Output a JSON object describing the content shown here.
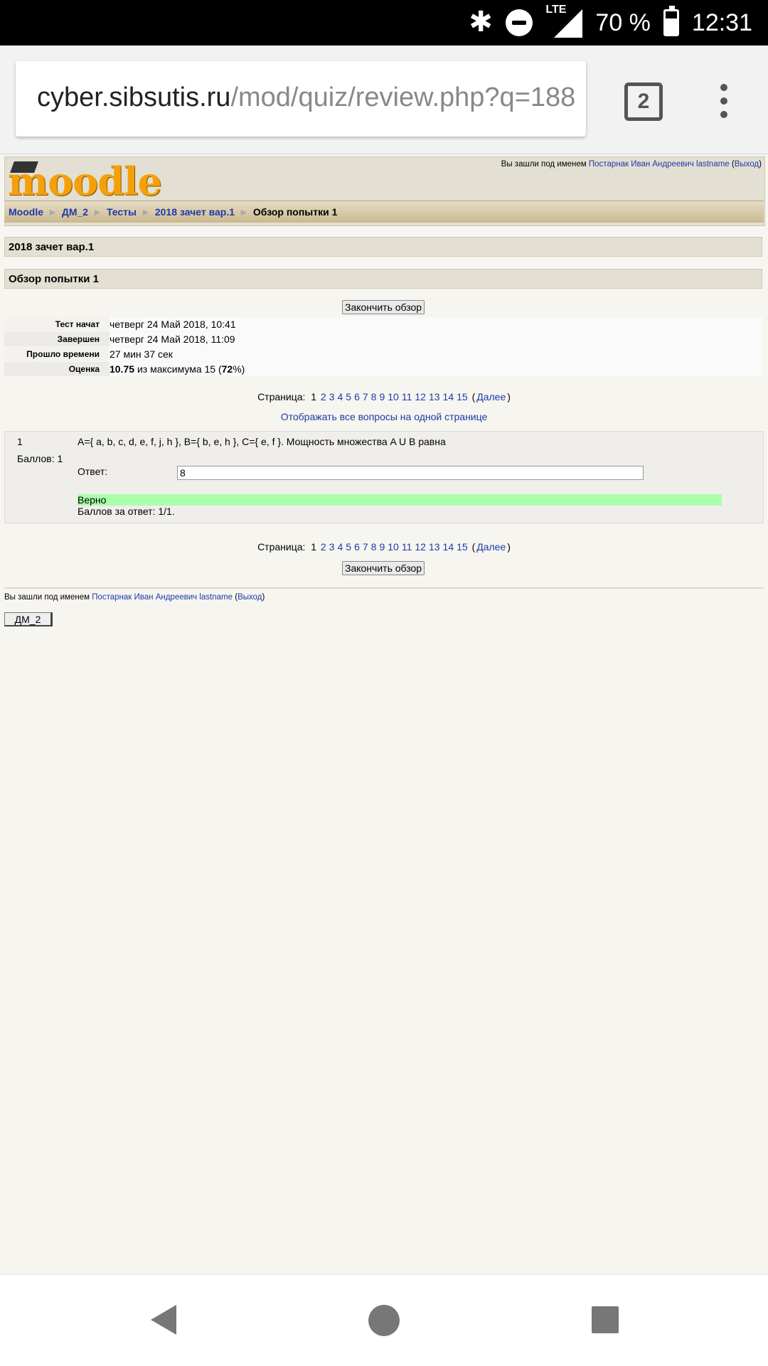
{
  "status_bar": {
    "battery": "70 %",
    "time": "12:31",
    "network": "LTE",
    "battery_level": 0.7
  },
  "browser": {
    "url_host": "cyber.sibsutis.ru",
    "url_path": "/mod/quiz/review.php?q=188",
    "tab_count": "2"
  },
  "header": {
    "logo": "moodle",
    "login_prefix": "Вы зашли под именем",
    "user_name": "Постарнак Иван Андреевич lastname",
    "logout": "Выход"
  },
  "breadcrumbs": [
    "Moodle",
    "ДМ_2",
    "Тесты",
    "2018 зачет вар.1"
  ],
  "breadcrumb_current": "Обзор попытки 1",
  "quiz_title": "2018 зачет вар.1",
  "attempt_title": "Обзор попытки 1",
  "finish_review": "Закончить обзор",
  "summary": [
    {
      "label": "Тест начат",
      "value": "четверг 24 Май 2018, 10:41"
    },
    {
      "label": "Завершен",
      "value": "четверг 24 Май 2018, 11:09"
    },
    {
      "label": "Прошло времени",
      "value": "27 мин 37 сек"
    }
  ],
  "grade": {
    "label": "Оценка",
    "score": "10.75",
    "middle": "из максимума 15 (",
    "percent": "72",
    "end": "%)"
  },
  "pager": {
    "label": "Страница:",
    "current": "1",
    "pages": [
      "2",
      "3",
      "4",
      "5",
      "6",
      "7",
      "8",
      "9",
      "10",
      "11",
      "12",
      "13",
      "14",
      "15"
    ],
    "next": "Далее"
  },
  "show_all": "Отображать все вопросы на одной странице",
  "question": {
    "number": "1",
    "grade": "Баллов: 1",
    "text": "A={ a, b, c, d, e, f, j, h }, B={ b, e, h }, C={ e, f }. Мощность множества A U B равна",
    "answer_label": "Ответ:",
    "answer_value": "8",
    "feedback": "Верно",
    "score": "Баллов за ответ: 1/1."
  },
  "footer": {
    "login_prefix": "Вы зашли под именем",
    "user_name": "Постарнак Иван Андреевич lastname",
    "logout": "Выход",
    "course_button": "ДМ_2"
  }
}
